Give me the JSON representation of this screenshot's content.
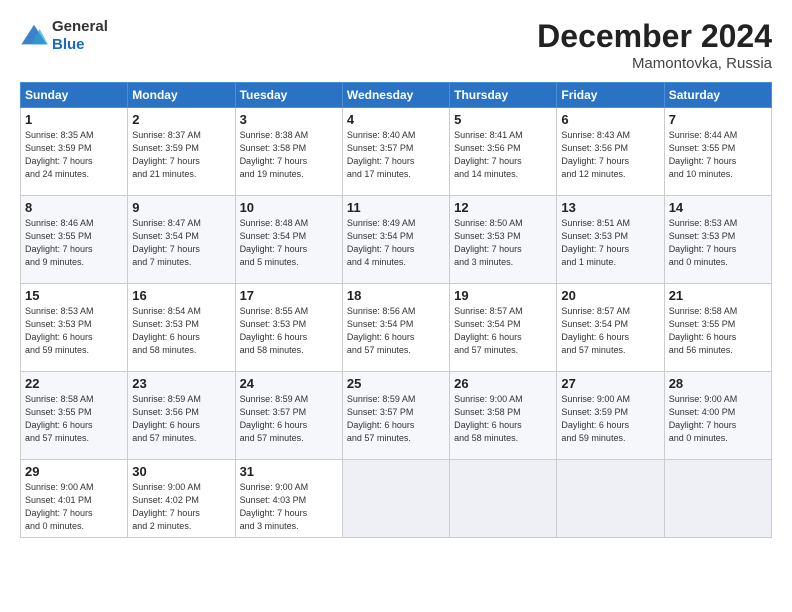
{
  "logo": {
    "general": "General",
    "blue": "Blue"
  },
  "title": "December 2024",
  "location": "Mamontovka, Russia",
  "days_of_week": [
    "Sunday",
    "Monday",
    "Tuesday",
    "Wednesday",
    "Thursday",
    "Friday",
    "Saturday"
  ],
  "weeks": [
    [
      {
        "day": "1",
        "info": "Sunrise: 8:35 AM\nSunset: 3:59 PM\nDaylight: 7 hours\nand 24 minutes."
      },
      {
        "day": "2",
        "info": "Sunrise: 8:37 AM\nSunset: 3:59 PM\nDaylight: 7 hours\nand 21 minutes."
      },
      {
        "day": "3",
        "info": "Sunrise: 8:38 AM\nSunset: 3:58 PM\nDaylight: 7 hours\nand 19 minutes."
      },
      {
        "day": "4",
        "info": "Sunrise: 8:40 AM\nSunset: 3:57 PM\nDaylight: 7 hours\nand 17 minutes."
      },
      {
        "day": "5",
        "info": "Sunrise: 8:41 AM\nSunset: 3:56 PM\nDaylight: 7 hours\nand 14 minutes."
      },
      {
        "day": "6",
        "info": "Sunrise: 8:43 AM\nSunset: 3:56 PM\nDaylight: 7 hours\nand 12 minutes."
      },
      {
        "day": "7",
        "info": "Sunrise: 8:44 AM\nSunset: 3:55 PM\nDaylight: 7 hours\nand 10 minutes."
      }
    ],
    [
      {
        "day": "8",
        "info": "Sunrise: 8:46 AM\nSunset: 3:55 PM\nDaylight: 7 hours\nand 9 minutes."
      },
      {
        "day": "9",
        "info": "Sunrise: 8:47 AM\nSunset: 3:54 PM\nDaylight: 7 hours\nand 7 minutes."
      },
      {
        "day": "10",
        "info": "Sunrise: 8:48 AM\nSunset: 3:54 PM\nDaylight: 7 hours\nand 5 minutes."
      },
      {
        "day": "11",
        "info": "Sunrise: 8:49 AM\nSunset: 3:54 PM\nDaylight: 7 hours\nand 4 minutes."
      },
      {
        "day": "12",
        "info": "Sunrise: 8:50 AM\nSunset: 3:53 PM\nDaylight: 7 hours\nand 3 minutes."
      },
      {
        "day": "13",
        "info": "Sunrise: 8:51 AM\nSunset: 3:53 PM\nDaylight: 7 hours\nand 1 minute."
      },
      {
        "day": "14",
        "info": "Sunrise: 8:53 AM\nSunset: 3:53 PM\nDaylight: 7 hours\nand 0 minutes."
      }
    ],
    [
      {
        "day": "15",
        "info": "Sunrise: 8:53 AM\nSunset: 3:53 PM\nDaylight: 6 hours\nand 59 minutes."
      },
      {
        "day": "16",
        "info": "Sunrise: 8:54 AM\nSunset: 3:53 PM\nDaylight: 6 hours\nand 58 minutes."
      },
      {
        "day": "17",
        "info": "Sunrise: 8:55 AM\nSunset: 3:53 PM\nDaylight: 6 hours\nand 58 minutes."
      },
      {
        "day": "18",
        "info": "Sunrise: 8:56 AM\nSunset: 3:54 PM\nDaylight: 6 hours\nand 57 minutes."
      },
      {
        "day": "19",
        "info": "Sunrise: 8:57 AM\nSunset: 3:54 PM\nDaylight: 6 hours\nand 57 minutes."
      },
      {
        "day": "20",
        "info": "Sunrise: 8:57 AM\nSunset: 3:54 PM\nDaylight: 6 hours\nand 57 minutes."
      },
      {
        "day": "21",
        "info": "Sunrise: 8:58 AM\nSunset: 3:55 PM\nDaylight: 6 hours\nand 56 minutes."
      }
    ],
    [
      {
        "day": "22",
        "info": "Sunrise: 8:58 AM\nSunset: 3:55 PM\nDaylight: 6 hours\nand 57 minutes."
      },
      {
        "day": "23",
        "info": "Sunrise: 8:59 AM\nSunset: 3:56 PM\nDaylight: 6 hours\nand 57 minutes."
      },
      {
        "day": "24",
        "info": "Sunrise: 8:59 AM\nSunset: 3:57 PM\nDaylight: 6 hours\nand 57 minutes."
      },
      {
        "day": "25",
        "info": "Sunrise: 8:59 AM\nSunset: 3:57 PM\nDaylight: 6 hours\nand 57 minutes."
      },
      {
        "day": "26",
        "info": "Sunrise: 9:00 AM\nSunset: 3:58 PM\nDaylight: 6 hours\nand 58 minutes."
      },
      {
        "day": "27",
        "info": "Sunrise: 9:00 AM\nSunset: 3:59 PM\nDaylight: 6 hours\nand 59 minutes."
      },
      {
        "day": "28",
        "info": "Sunrise: 9:00 AM\nSunset: 4:00 PM\nDaylight: 7 hours\nand 0 minutes."
      }
    ],
    [
      {
        "day": "29",
        "info": "Sunrise: 9:00 AM\nSunset: 4:01 PM\nDaylight: 7 hours\nand 0 minutes."
      },
      {
        "day": "30",
        "info": "Sunrise: 9:00 AM\nSunset: 4:02 PM\nDaylight: 7 hours\nand 2 minutes."
      },
      {
        "day": "31",
        "info": "Sunrise: 9:00 AM\nSunset: 4:03 PM\nDaylight: 7 hours\nand 3 minutes."
      },
      null,
      null,
      null,
      null
    ]
  ]
}
